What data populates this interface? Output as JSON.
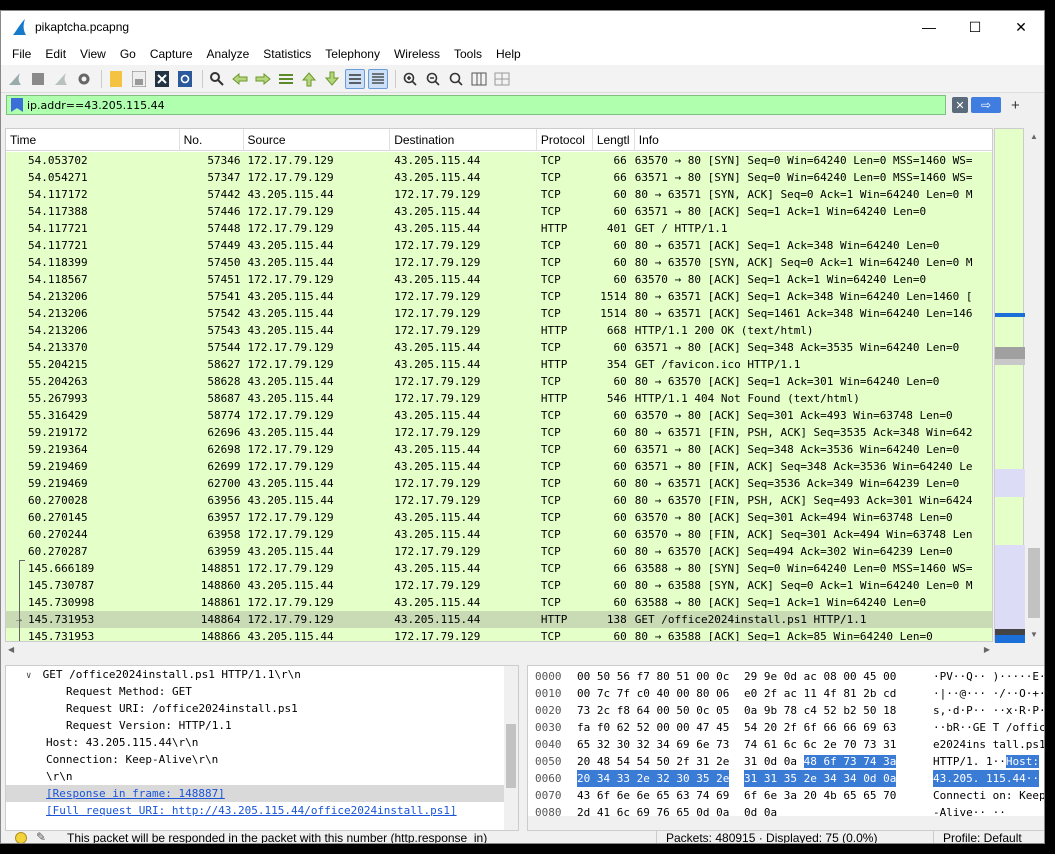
{
  "window": {
    "title": "pikaptcha.pcapng",
    "minimize": "—",
    "maximize": "☐",
    "close": "✕"
  },
  "menu": [
    "File",
    "Edit",
    "View",
    "Go",
    "Capture",
    "Analyze",
    "Statistics",
    "Telephony",
    "Wireless",
    "Tools",
    "Help"
  ],
  "toolbar_icons": [
    "shark-fin-start-icon",
    "stop-square-icon",
    "restart-capture-icon",
    "capture-options-gear-icon",
    "open-folder-icon",
    "save-file-icon",
    "close-file-icon",
    "reload-icon",
    "find-packet-icon",
    "go-back-icon",
    "go-forward-icon",
    "go-to-packet-icon",
    "go-first-icon",
    "go-last-icon",
    "auto-scroll-icon",
    "colorize-icon",
    "zoom-in-icon",
    "zoom-out-icon",
    "zoom-normal-icon",
    "resize-columns-icon",
    "grid-icon"
  ],
  "filter": {
    "value": "ip.addr==43.205.115.44",
    "apply_glyph": "⇨",
    "clear_glyph": "✕",
    "add_glyph": "+"
  },
  "columns": [
    "Time",
    "No.",
    "Source",
    "Destination",
    "Protocol",
    "Lengtl",
    "Info"
  ],
  "packets": [
    {
      "time": "54.053702",
      "no": "57346",
      "src": "172.17.79.129",
      "dst": "43.205.115.44",
      "proto": "TCP",
      "len": "66",
      "info": "63570 → 80 [SYN] Seq=0 Win=64240 Len=0 MSS=1460 WS="
    },
    {
      "time": "54.054271",
      "no": "57347",
      "src": "172.17.79.129",
      "dst": "43.205.115.44",
      "proto": "TCP",
      "len": "66",
      "info": "63571 → 80 [SYN] Seq=0 Win=64240 Len=0 MSS=1460 WS="
    },
    {
      "time": "54.117172",
      "no": "57442",
      "src": "43.205.115.44",
      "dst": "172.17.79.129",
      "proto": "TCP",
      "len": "60",
      "info": "80 → 63571 [SYN, ACK] Seq=0 Ack=1 Win=64240 Len=0 M"
    },
    {
      "time": "54.117388",
      "no": "57446",
      "src": "172.17.79.129",
      "dst": "43.205.115.44",
      "proto": "TCP",
      "len": "60",
      "info": "63571 → 80 [ACK] Seq=1 Ack=1 Win=64240 Len=0"
    },
    {
      "time": "54.117721",
      "no": "57448",
      "src": "172.17.79.129",
      "dst": "43.205.115.44",
      "proto": "HTTP",
      "len": "401",
      "info": "GET / HTTP/1.1"
    },
    {
      "time": "54.117721",
      "no": "57449",
      "src": "43.205.115.44",
      "dst": "172.17.79.129",
      "proto": "TCP",
      "len": "60",
      "info": "80 → 63571 [ACK] Seq=1 Ack=348 Win=64240 Len=0"
    },
    {
      "time": "54.118399",
      "no": "57450",
      "src": "43.205.115.44",
      "dst": "172.17.79.129",
      "proto": "TCP",
      "len": "60",
      "info": "80 → 63570 [SYN, ACK] Seq=0 Ack=1 Win=64240 Len=0 M"
    },
    {
      "time": "54.118567",
      "no": "57451",
      "src": "172.17.79.129",
      "dst": "43.205.115.44",
      "proto": "TCP",
      "len": "60",
      "info": "63570 → 80 [ACK] Seq=1 Ack=1 Win=64240 Len=0"
    },
    {
      "time": "54.213206",
      "no": "57541",
      "src": "43.205.115.44",
      "dst": "172.17.79.129",
      "proto": "TCP",
      "len": "1514",
      "info": "80 → 63571 [ACK] Seq=1 Ack=348 Win=64240 Len=1460 ["
    },
    {
      "time": "54.213206",
      "no": "57542",
      "src": "43.205.115.44",
      "dst": "172.17.79.129",
      "proto": "TCP",
      "len": "1514",
      "info": "80 → 63571 [ACK] Seq=1461 Ack=348 Win=64240 Len=146"
    },
    {
      "time": "54.213206",
      "no": "57543",
      "src": "43.205.115.44",
      "dst": "172.17.79.129",
      "proto": "HTTP",
      "len": "668",
      "info": "HTTP/1.1 200 OK  (text/html)"
    },
    {
      "time": "54.213370",
      "no": "57544",
      "src": "172.17.79.129",
      "dst": "43.205.115.44",
      "proto": "TCP",
      "len": "60",
      "info": "63571 → 80 [ACK] Seq=348 Ack=3535 Win=64240 Len=0"
    },
    {
      "time": "55.204215",
      "no": "58627",
      "src": "172.17.79.129",
      "dst": "43.205.115.44",
      "proto": "HTTP",
      "len": "354",
      "info": "GET /favicon.ico HTTP/1.1"
    },
    {
      "time": "55.204263",
      "no": "58628",
      "src": "43.205.115.44",
      "dst": "172.17.79.129",
      "proto": "TCP",
      "len": "60",
      "info": "80 → 63570 [ACK] Seq=1 Ack=301 Win=64240 Len=0"
    },
    {
      "time": "55.267993",
      "no": "58687",
      "src": "43.205.115.44",
      "dst": "172.17.79.129",
      "proto": "HTTP",
      "len": "546",
      "info": "HTTP/1.1 404 Not Found  (text/html)"
    },
    {
      "time": "55.316429",
      "no": "58774",
      "src": "172.17.79.129",
      "dst": "43.205.115.44",
      "proto": "TCP",
      "len": "60",
      "info": "63570 → 80 [ACK] Seq=301 Ack=493 Win=63748 Len=0"
    },
    {
      "time": "59.219172",
      "no": "62696",
      "src": "43.205.115.44",
      "dst": "172.17.79.129",
      "proto": "TCP",
      "len": "60",
      "info": "80 → 63571 [FIN, PSH, ACK] Seq=3535 Ack=348 Win=642"
    },
    {
      "time": "59.219364",
      "no": "62698",
      "src": "172.17.79.129",
      "dst": "43.205.115.44",
      "proto": "TCP",
      "len": "60",
      "info": "63571 → 80 [ACK] Seq=348 Ack=3536 Win=64240 Len=0"
    },
    {
      "time": "59.219469",
      "no": "62699",
      "src": "172.17.79.129",
      "dst": "43.205.115.44",
      "proto": "TCP",
      "len": "60",
      "info": "63571 → 80 [FIN, ACK] Seq=348 Ack=3536 Win=64240 Le"
    },
    {
      "time": "59.219469",
      "no": "62700",
      "src": "43.205.115.44",
      "dst": "172.17.79.129",
      "proto": "TCP",
      "len": "60",
      "info": "80 → 63571 [ACK] Seq=3536 Ack=349 Win=64239 Len=0"
    },
    {
      "time": "60.270028",
      "no": "63956",
      "src": "43.205.115.44",
      "dst": "172.17.79.129",
      "proto": "TCP",
      "len": "60",
      "info": "80 → 63570 [FIN, PSH, ACK] Seq=493 Ack=301 Win=6424"
    },
    {
      "time": "60.270145",
      "no": "63957",
      "src": "172.17.79.129",
      "dst": "43.205.115.44",
      "proto": "TCP",
      "len": "60",
      "info": "63570 → 80 [ACK] Seq=301 Ack=494 Win=63748 Len=0"
    },
    {
      "time": "60.270244",
      "no": "63958",
      "src": "172.17.79.129",
      "dst": "43.205.115.44",
      "proto": "TCP",
      "len": "60",
      "info": "63570 → 80 [FIN, ACK] Seq=301 Ack=494 Win=63748 Len"
    },
    {
      "time": "60.270287",
      "no": "63959",
      "src": "43.205.115.44",
      "dst": "172.17.79.129",
      "proto": "TCP",
      "len": "60",
      "info": "80 → 63570 [ACK] Seq=494 Ack=302 Win=64239 Len=0"
    },
    {
      "time": "145.666189",
      "no": "148851",
      "src": "172.17.79.129",
      "dst": "43.205.115.44",
      "proto": "TCP",
      "len": "66",
      "info": "63588 → 80 [SYN] Seq=0 Win=64240 Len=0 MSS=1460 WS="
    },
    {
      "time": "145.730787",
      "no": "148860",
      "src": "43.205.115.44",
      "dst": "172.17.79.129",
      "proto": "TCP",
      "len": "60",
      "info": "80 → 63588 [SYN, ACK] Seq=0 Ack=1 Win=64240 Len=0 M"
    },
    {
      "time": "145.730998",
      "no": "148861",
      "src": "172.17.79.129",
      "dst": "43.205.115.44",
      "proto": "TCP",
      "len": "60",
      "info": "63588 → 80 [ACK] Seq=1 Ack=1 Win=64240 Len=0"
    },
    {
      "time": "145.731953",
      "no": "148864",
      "src": "172.17.79.129",
      "dst": "43.205.115.44",
      "proto": "HTTP",
      "len": "138",
      "info": "GET /office2024install.ps1 HTTP/1.1",
      "selected": true
    },
    {
      "time": "145.731953",
      "no": "148866",
      "src": "43.205.115.44",
      "dst": "172.17.79.129",
      "proto": "TCP",
      "len": "60",
      "info": "80 → 63588 [ACK] Seq=1 Ack=85 Win=64240 Len=0"
    }
  ],
  "details": [
    {
      "indent": 2,
      "chevron": "∨",
      "text": "GET /office2024install.ps1 HTTP/1.1\\r\\n"
    },
    {
      "indent": 6,
      "text": "Request Method: GET"
    },
    {
      "indent": 6,
      "text": "Request URI: /office2024install.ps1"
    },
    {
      "indent": 6,
      "text": "Request Version: HTTP/1.1"
    },
    {
      "indent": 4,
      "text": "Host: 43.205.115.44\\r\\n"
    },
    {
      "indent": 4,
      "text": "Connection: Keep-Alive\\r\\n"
    },
    {
      "indent": 4,
      "text": "\\r\\n"
    },
    {
      "indent": 4,
      "text": "[Response in frame: 148887]",
      "link": true,
      "highlight": true
    },
    {
      "indent": 4,
      "text": "[Full request URI: http://43.205.115.44/office2024install.ps1]",
      "link": true
    }
  ],
  "bytes": [
    {
      "off": "0000",
      "h1": "00 50 56 f7 80 51 00 0c",
      "h2": "29 9e 0d ac 08 00 45 00",
      "asc": "·PV··Q·· )·····E·"
    },
    {
      "off": "0010",
      "h1": "00 7c 7f c0 40 00 80 06",
      "h2": "e0 2f ac 11 4f 81 2b cd",
      "asc": "·|··@··· ·/··O·+·"
    },
    {
      "off": "0020",
      "h1": "73 2c f8 64 00 50 0c 05",
      "h2": "0a 9b 78 c4 52 b2 50 18",
      "asc": "s,·d·P·· ··x·R·P·"
    },
    {
      "off": "0030",
      "h1": "fa f0 62 52 00 00 47 45",
      "h2": "54 20 2f 6f 66 66 69 63",
      "asc": "··bR··GE T /offic"
    },
    {
      "off": "0040",
      "h1": "65 32 30 32 34 69 6e 73",
      "h2": "74 61 6c 6c 2e 70 73 31",
      "asc": "e2024ins tall.ps1"
    },
    {
      "off": "0050",
      "h1": "20 48 54 54 50 2f 31 2e",
      "h2a": "31 0d 0a ",
      "h2b": "48 6f 73 74 3a",
      "asca": " HTTP/1. 1··",
      "ascb": "Host:"
    },
    {
      "off": "0060",
      "h1sel": "20 34 33 2e 32 30 35 2e",
      "h2sel": "31 31 35 2e 34 34 0d 0a",
      "ascsel": " 43.205. 115.44··"
    },
    {
      "off": "0070",
      "h1": "43 6f 6e 6e 65 63 74 69",
      "h2": "6f 6e 3a 20 4b 65 65 70",
      "asc": "Connecti on: Keep"
    },
    {
      "off": "0080",
      "h1": "2d 41 6c 69 76 65 0d 0a",
      "h2": "0d 0a",
      "asc": "-Alive·· ··"
    }
  ],
  "status": {
    "message": "This packet will be responded in the packet with this number (http.response_in)",
    "packets": "Packets: 480915 · Displayed: 75 (0.0%)",
    "profile": "Profile: Default"
  }
}
